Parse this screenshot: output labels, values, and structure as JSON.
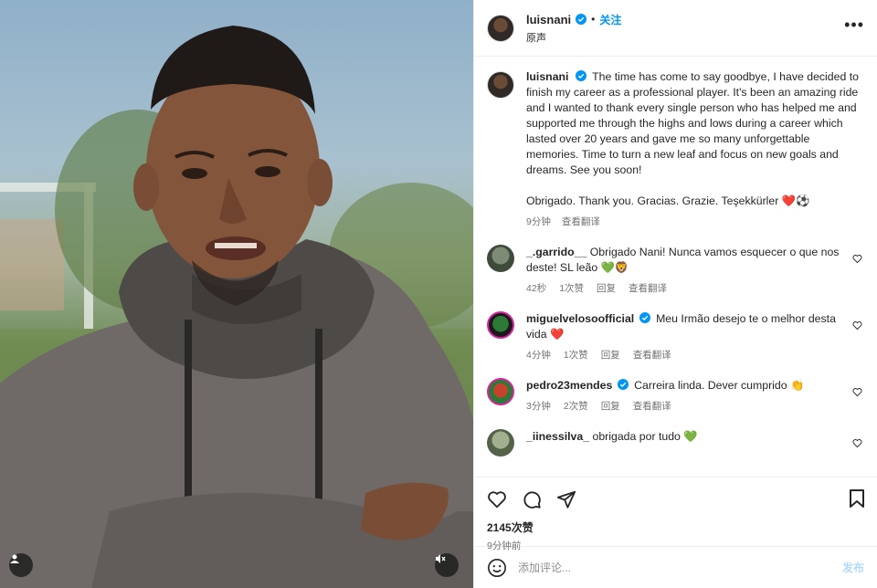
{
  "header": {
    "username": "luisnani",
    "separator": "•",
    "follow_label": "关注",
    "audio_label": "原声",
    "more_label": "•••"
  },
  "caption": {
    "username": "luisnani",
    "text": "The time has come to say goodbye, I have decided to finish my career as a professional player. It's been an amazing ride and I wanted to thank every single person who has helped me and supported me through the highs and lows during a career which lasted over 20 years and gave me so many unforgettable memories. Time to turn a new leaf and focus on new goals and dreams. See you soon!",
    "thanks": "Obrigado. Thank you. Gracias. Grazie. Teşekkürler ❤️⚽",
    "time": "9分钟",
    "translate": "查看翻译"
  },
  "comments": [
    {
      "username": "_.garrido__",
      "verified": false,
      "text": "Obrigado Nani! Nunca vamos esquecer o que nos deste! SL leão 💚🦁",
      "time": "42秒",
      "likes": "1次赞",
      "reply": "回复",
      "translate": "查看翻译"
    },
    {
      "username": "miguelvelosoofficial",
      "verified": true,
      "text": "Meu Irmão desejo te o melhor desta vida ❤️",
      "time": "4分钟",
      "likes": "1次赞",
      "reply": "回复",
      "translate": "查看翻译"
    },
    {
      "username": "pedro23mendes",
      "verified": true,
      "text": "Carreira linda. Dever cumprido 👏",
      "time": "3分钟",
      "likes": "2次赞",
      "reply": "回复",
      "translate": "查看翻译"
    },
    {
      "username": "_iinessilva_",
      "verified": false,
      "text": "obrigada por tudo 💚"
    }
  ],
  "actions": {
    "likes": "2145次赞",
    "post_time": "9分钟前",
    "icons": [
      "heart-icon",
      "comment-icon",
      "share-icon",
      "bookmark-icon"
    ]
  },
  "add_comment": {
    "placeholder": "添加评论...",
    "post_label": "发布"
  },
  "colors": {
    "accent": "#0095f6",
    "verified": "#0095f6",
    "muted": "#737373",
    "border": "#efefef"
  }
}
